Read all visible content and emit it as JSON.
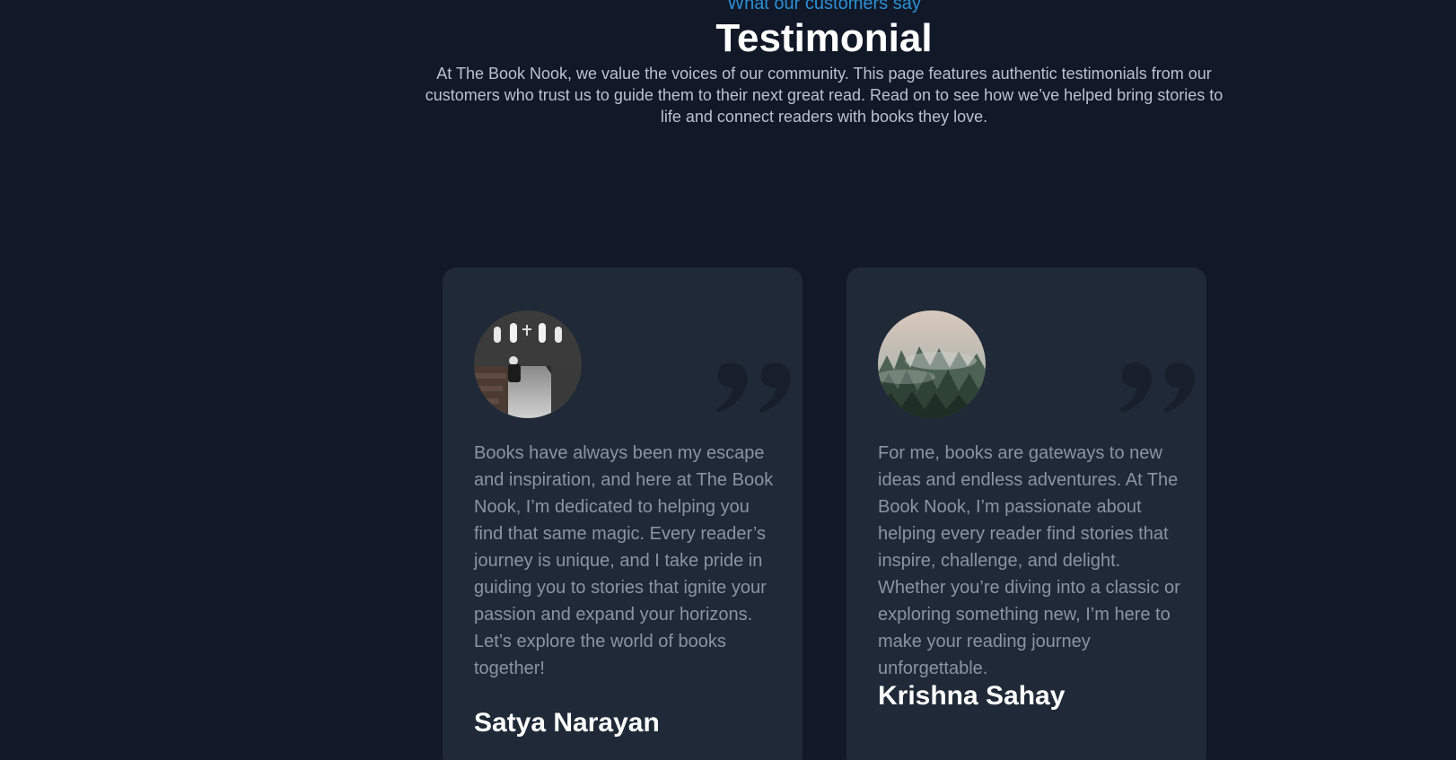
{
  "section": {
    "eyebrow": "What our customers say",
    "title": "Testimonial",
    "intro": "At The Book Nook, we value the voices of our community. This page features authentic testimonials from our customers who trust us to guide them to their next great read. Read on to see how we’ve helped bring stories to life and connect readers with books they love."
  },
  "testimonials": [
    {
      "text": "Books have always been my escape and inspiration, and here at The Book Nook, I’m dedicated to helping you find that same magic. Every reader’s journey is unique, and I take pride in guiding you to stories that ignite your passion and expand your horizons. Let’s explore the world of books together!",
      "author": "Satya Narayan",
      "avatar_icon": "church-interior-photo"
    },
    {
      "text": "For me, books are gateways to new ideas and endless adventures. At The Book Nook, I’m passionate about helping every reader find stories that inspire, challenge, and delight. Whether you’re diving into a classic or exploring something new, I’m here to make your reading journey unforgettable.",
      "author": "Krishna Sahay",
      "avatar_icon": "misty-forest-photo"
    }
  ],
  "colors": {
    "background": "#111827",
    "card": "#1f2937",
    "accent": "#2b8fd6",
    "heading": "#ffffff",
    "body_text": "#8a94a3"
  }
}
